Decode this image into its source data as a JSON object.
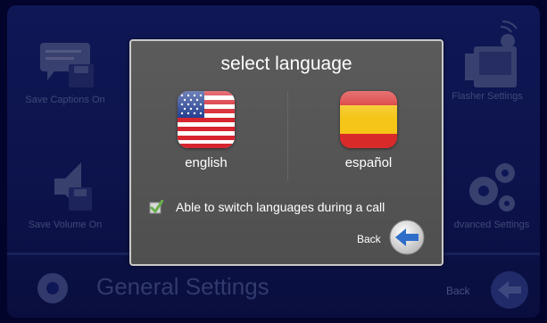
{
  "background": {
    "tiles": [
      {
        "label": "Save Captions On",
        "icon": "captions-save-icon"
      },
      {
        "label": "Flasher Settings",
        "icon": "flasher-icon"
      },
      {
        "label": "Save Volume On",
        "icon": "volume-save-icon"
      },
      {
        "label": "dvanced Settings",
        "icon": "gears-icon"
      }
    ],
    "section_title": "General Settings",
    "back_label": "Back"
  },
  "dialog": {
    "title": "select language",
    "options": [
      {
        "label": "english",
        "icon": "us-flag-icon"
      },
      {
        "label": "español",
        "icon": "spain-flag-icon"
      }
    ],
    "checkbox": {
      "label": "Able to switch languages during a call",
      "checked": true
    },
    "back_label": "Back"
  },
  "colors": {
    "background": "#1c2c8c",
    "dialog": "#555555",
    "dialog_border": "#c9c9c9",
    "accent": "#2f6ec8",
    "check": "#6ab04c"
  }
}
